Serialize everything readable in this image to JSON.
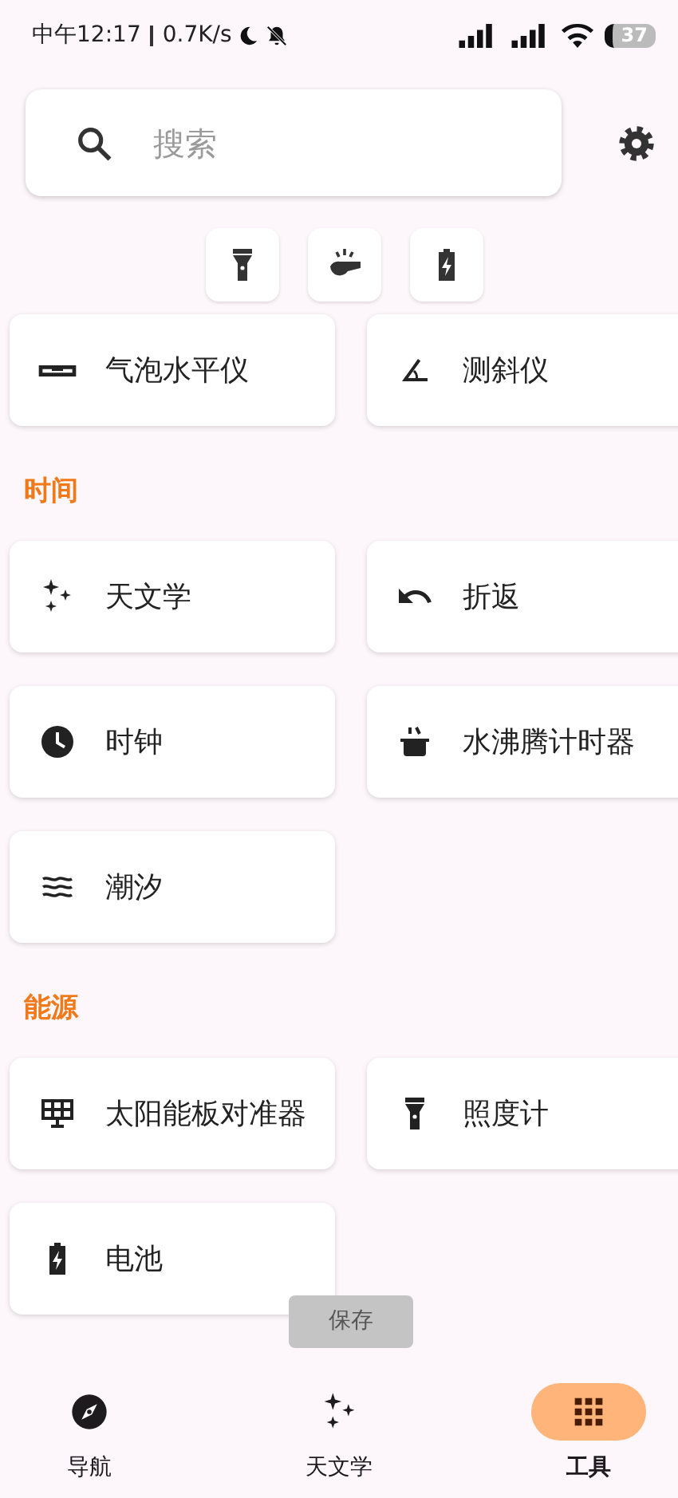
{
  "status_bar": {
    "time": "中午12:17",
    "speed": "0.7K/s",
    "battery": "37"
  },
  "search": {
    "placeholder": "搜索"
  },
  "quick_actions": [
    {
      "kind": "flashlight"
    },
    {
      "kind": "whistle"
    },
    {
      "kind": "battery"
    }
  ],
  "sections": [
    {
      "tools": [
        {
          "label": "气泡水平仪",
          "kind": "level"
        },
        {
          "label": "测斜仪",
          "kind": "angle"
        }
      ]
    },
    {
      "title": "时间",
      "tools": [
        {
          "label": "天文学",
          "kind": "sparkles"
        },
        {
          "label": "折返",
          "kind": "undo"
        },
        {
          "label": "时钟",
          "kind": "clock"
        },
        {
          "label": "水沸腾计时器",
          "kind": "pot"
        },
        {
          "label": "潮汐",
          "kind": "waves"
        }
      ]
    },
    {
      "title": "能源",
      "tools": [
        {
          "label": "太阳能板对准器",
          "kind": "solar"
        },
        {
          "label": "照度计",
          "kind": "flashlight"
        },
        {
          "label": "电池",
          "kind": "battery"
        }
      ]
    }
  ],
  "nav": [
    {
      "label": "导航",
      "kind": "compass",
      "selected": false
    },
    {
      "label": "天文学",
      "kind": "sparkles",
      "selected": false
    },
    {
      "label": "工具",
      "kind": "grid",
      "selected": true
    }
  ],
  "toast": {
    "text": "保存"
  }
}
